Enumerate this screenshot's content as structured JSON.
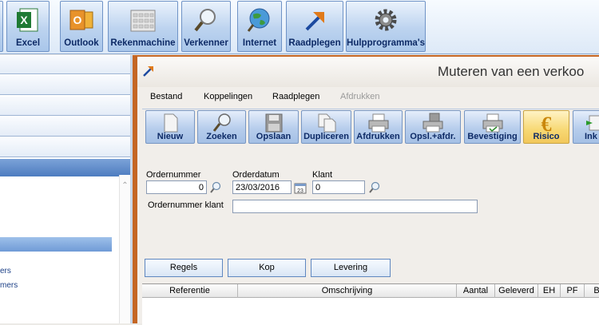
{
  "launcher": {
    "items": [
      {
        "label": "Excel",
        "icon": "excel-icon"
      },
      {
        "label": "Outlook",
        "icon": "outlook-icon"
      },
      {
        "label": "Rekenmachine",
        "icon": "calculator-icon"
      },
      {
        "label": "Verkenner",
        "icon": "magnifier-icon"
      },
      {
        "label": "Internet",
        "icon": "globe-icon"
      },
      {
        "label": "Raadplegen",
        "icon": "arrow-icon"
      },
      {
        "label": "Hulpprogramma's",
        "icon": "gear-icon"
      }
    ]
  },
  "window": {
    "title": "Muteren van een verkoo"
  },
  "menu": {
    "bestand": "Bestand",
    "koppelingen": "Koppelingen",
    "raadplegen": "Raadplegen",
    "afdrukken": "Afdrukken"
  },
  "toolbar": {
    "items": [
      {
        "label": "Nieuw",
        "icon": "new-document-icon"
      },
      {
        "label": "Zoeken",
        "icon": "search-icon"
      },
      {
        "label": "Opslaan",
        "icon": "save-icon"
      },
      {
        "label": "Dupliceren",
        "icon": "duplicate-icon"
      },
      {
        "label": "Afdrukken",
        "icon": "printer-icon"
      },
      {
        "label": "Opsl.+afdr.",
        "icon": "save-print-icon"
      },
      {
        "label": "Bevestiging",
        "icon": "confirm-print-icon"
      },
      {
        "label": "Risico",
        "icon": "euro-icon"
      },
      {
        "label": "Ink",
        "icon": "purchase-icon"
      }
    ]
  },
  "form": {
    "ordernummer_label": "Ordernummer",
    "ordernummer_value": "0",
    "orderdatum_label": "Orderdatum",
    "orderdatum_value": "23/03/2016",
    "klant_label": "Klant",
    "klant_value": "0",
    "ordernummer_klant_label": "Ordernummer klant",
    "ordernummer_klant_value": ""
  },
  "tabs": {
    "regels": "Regels",
    "kop": "Kop",
    "levering": "Levering"
  },
  "grid": {
    "columns": [
      "Referentie",
      "Omschrijving",
      "Aantal",
      "Geleverd",
      "EH",
      "PF",
      "B"
    ]
  },
  "leftpane": {
    "items": [
      "ers",
      "mers"
    ]
  },
  "colors": {
    "accent": "#c46624",
    "toolbar_highlight": "#f7d873",
    "launcher_text": "#0d2a66"
  }
}
